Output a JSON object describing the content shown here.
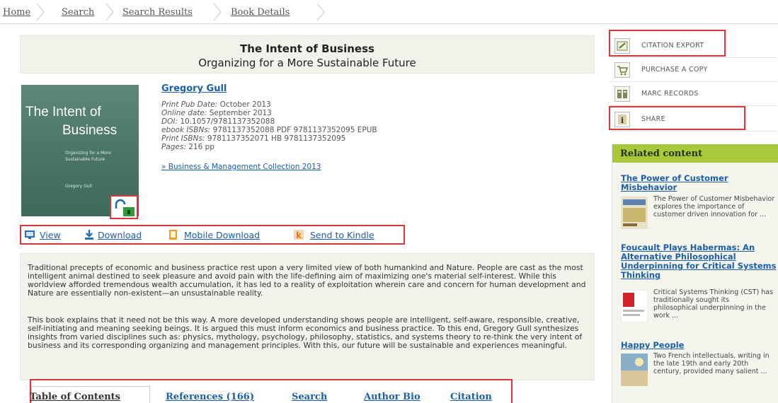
{
  "breadcrumb": [
    "Home",
    "Search",
    "Search Results",
    "Book Details"
  ],
  "book": {
    "title": "The Intent of Business",
    "subtitle": "Organizing for a More Sustainable Future",
    "cover_title_line1": "The Intent of",
    "cover_title_line2": "Business",
    "cover_subtitle": "Organizing for a More Sustainable Future",
    "cover_author": "Gregory Gull",
    "author": "Gregory Gull",
    "meta": [
      {
        "label": "Print Pub Date:",
        "value": "October 2013"
      },
      {
        "label": "Online date:",
        "value": "September 2013"
      },
      {
        "label": "DOI:",
        "value": "10.1057/9781137352088"
      },
      {
        "label": "ebook ISBNs:",
        "value": "9781137352088 PDF 9781137352095 EPUB"
      },
      {
        "label": "Print ISBNs:",
        "value": "9781137352071 HB 9781137352095"
      },
      {
        "label": "Pages:",
        "value": "216 pp"
      }
    ],
    "collection": "» Business & Management Collection 2013"
  },
  "actions": {
    "view": "View",
    "download": "Download",
    "mobile_download": "Mobile Download",
    "send_to_kindle": "Send to Kindle"
  },
  "abstract": {
    "p1": "Traditional precepts of economic and business practice rest upon a very limited view of both humankind and Nature. People are cast as the most intelligent animal destined to seek pleasure and avoid pain with the life-defining aim of maximizing one's material self-interest. While this worldview afforded tremendous wealth accumulation, it has led to a reality of exploitation wherein care and concern for human development and Nature are essentially non-existent—an unsustainable reality.",
    "p2": "This book explains that it need not be this way. A more developed understanding shows people are intelligent, self-aware, responsible, creative, self-initiating and meaning seeking beings. It is argued this must inform economics and business practice. To this end, Gregory Gull synthesizes insights from varied disciplines such as: physics, mythology, psychology, philosophy, statistics, and systems theory to re-think the very intent of business and its corresponding organizing and management principles. With this, our future will be sustainable and experiences meaningful."
  },
  "tabs": [
    "Table of Contents",
    "References (166)",
    "Search",
    "Author Bio",
    "Citation"
  ],
  "sidebar": {
    "items": [
      {
        "label": "CITATION EXPORT",
        "icon": "citation-export-icon"
      },
      {
        "label": "PURCHASE A COPY",
        "icon": "shopping-cart-icon"
      },
      {
        "label": "MARC RECORDS",
        "icon": "marc-records-icon"
      },
      {
        "label": "SHARE",
        "icon": "info-icon"
      }
    ],
    "related_header": "Related content",
    "related": [
      {
        "title": "The Power of Customer Misbehavior",
        "text": "The Power of Customer Misbehavior explores the importance of customer driven innovation for ..."
      },
      {
        "title": "Foucault Plays Habermas: An Alternative Philosophical Underpinning for Critical Systems Thinking",
        "text": "Critical Systems Thinking (CST) has traditionally sought its philosophical underpinning in the work ..."
      },
      {
        "title": "Happy People",
        "text": "Two French intellectuals, writing in the late 19th and early 20th century, provided many salient ..."
      }
    ]
  },
  "colors": {
    "link": "#1c5ea8",
    "highlight_box": "#d9363e",
    "related_header": "#a9c93b",
    "banner_bg": "#f2f2ea"
  }
}
